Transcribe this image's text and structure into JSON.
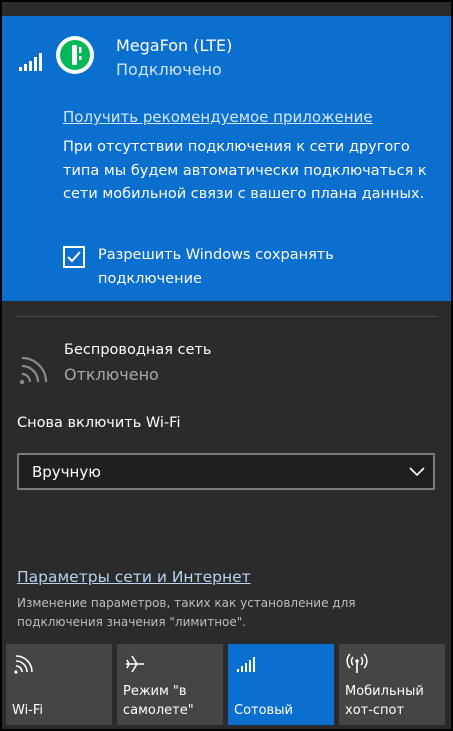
{
  "cellular": {
    "carrier": "MegaFon (LTE)",
    "status": "Подключено",
    "recommend_link": "Получить рекомендуемое приложение",
    "info": "При отсутствии подключения к сети другого типа мы будем автоматически подключаться к сети мобильной связи с вашего плана данных.",
    "allow_label": "Разрешить Windows сохранять подключение",
    "allow_checked": true
  },
  "wifi": {
    "title": "Беспроводная сеть",
    "status": "Отключено",
    "reenable_label": "Снова включить Wi-Fi",
    "dropdown_value": "Вручную"
  },
  "settings": {
    "link": "Параметры сети и Интернет",
    "description": "Изменение параметров, таких как установление для подключения значения \"лимитное\"."
  },
  "tiles": [
    {
      "label": "Wi-Fi",
      "icon": "wifi-icon",
      "active": false
    },
    {
      "label": "Режим \"в самолете\"",
      "icon": "airplane-icon",
      "active": false
    },
    {
      "label": "Сотовый",
      "icon": "cellular-icon",
      "active": true
    },
    {
      "label": "Мобильный хот-спот",
      "icon": "hotspot-icon",
      "active": false
    }
  ],
  "colors": {
    "accent": "#0a6fcf",
    "panel_bg": "#2b2b2b",
    "tile_bg": "#454545",
    "logo_green": "#00b956"
  }
}
